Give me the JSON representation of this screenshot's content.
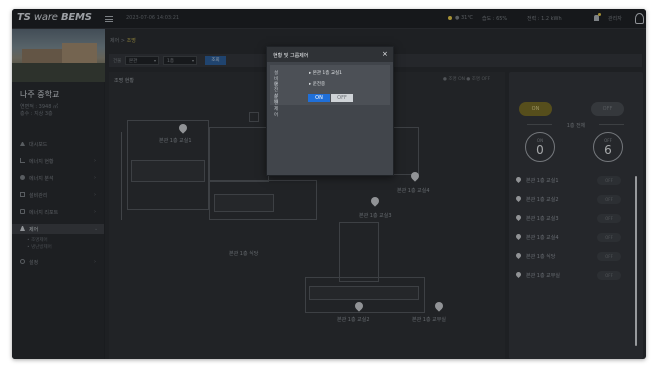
{
  "app": {
    "brand_prefix": "TS",
    "brand_light": "ware",
    "brand_suffix": "BEMS",
    "datetime": "2023-07-06 14:03:21"
  },
  "status": {
    "weather": "● 31℃",
    "humidity": "습도 : 65%",
    "power": "전력 : 1.2 kWh",
    "user": "관리자"
  },
  "sidebar": {
    "school_name": "나주 중학교",
    "area": "연면적 : 3948 ㎡",
    "floors": "층수 : 지상 3층",
    "menu": [
      {
        "label": "대시보드",
        "icon": "home-icon"
      },
      {
        "label": "에너지 현황",
        "icon": "bar-chart-icon"
      },
      {
        "label": "에너지 분석",
        "icon": "pie-icon"
      },
      {
        "label": "설비관리",
        "icon": "grid-icon"
      },
      {
        "label": "에너지 리포트",
        "icon": "report-icon"
      },
      {
        "label": "제어",
        "icon": "control-icon"
      },
      {
        "label": "설정",
        "icon": "gear-icon"
      }
    ],
    "sub_items": [
      "• 조명제어",
      "• 냉난방제어"
    ]
  },
  "main": {
    "breadcrumb_home": "제어",
    "breadcrumb_sep": ">",
    "breadcrumb_current": "조명",
    "filter_label": "건물",
    "filter_building": "본관",
    "filter_floor": "1층",
    "search_label": "조회",
    "plan_title": "조명 현황",
    "legend": "● 조명 ON  ● 조명 OFF"
  },
  "floor_markers": [
    {
      "label": "본관 1층 교실1"
    },
    {
      "label": "본관 1층 교실2"
    },
    {
      "label": "본관 1층 교실3"
    },
    {
      "label": "본관 1층 식당"
    },
    {
      "label": "본관 1층 교실4"
    },
    {
      "label": "본관 1층 교무실"
    }
  ],
  "right_panel": {
    "on_label": "ON",
    "off_label": "OFF",
    "title": "1층 전체",
    "on_gauge_label": "ON",
    "on_count": "0",
    "off_gauge_label": "OFF",
    "off_count": "6",
    "devices": [
      {
        "name": "본관 1층 교실1",
        "state": "OFF"
      },
      {
        "name": "본관 1층 교실2",
        "state": "OFF"
      },
      {
        "name": "본관 1층 교실3",
        "state": "OFF"
      },
      {
        "name": "본관 1층 교실4",
        "state": "OFF"
      },
      {
        "name": "본관 1층 식당",
        "state": "OFF"
      },
      {
        "name": "본관 1층 교무실",
        "state": "OFF"
      }
    ]
  },
  "modal": {
    "title": "현황 및 그룹제어",
    "close": "×",
    "rows": [
      {
        "key": "설비명",
        "value": "▸ 본관 1층 교실1"
      },
      {
        "key": "운전상태",
        "value": "▸ 운전중"
      }
    ],
    "control_key": "운전제어",
    "on_label": "ON",
    "off_label": "OFF"
  }
}
